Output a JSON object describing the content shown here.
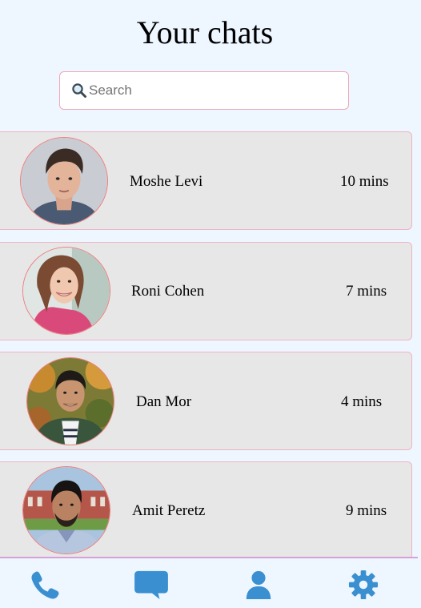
{
  "page": {
    "title": "Your chats"
  },
  "search": {
    "placeholder": "Search",
    "icon": "magnifying-glass-icon"
  },
  "chats": [
    {
      "name": "Moshe Levi",
      "time": "10 mins"
    },
    {
      "name": "Roni Cohen",
      "time": "7 mins"
    },
    {
      "name": "Dan Mor",
      "time": "4 mins"
    },
    {
      "name": "Amit Peretz",
      "time": "9 mins"
    }
  ],
  "nav": {
    "items": [
      "phone-icon",
      "chat-bubble-icon",
      "user-icon",
      "gear-icon"
    ],
    "icon_color": "#3a8fd1"
  },
  "colors": {
    "background": "#eef6ff",
    "card_background": "#e8e7e8",
    "card_border": "#f0b4c2",
    "avatar_border": "#f07b7b",
    "nav_divider": "#d7a0d6"
  }
}
